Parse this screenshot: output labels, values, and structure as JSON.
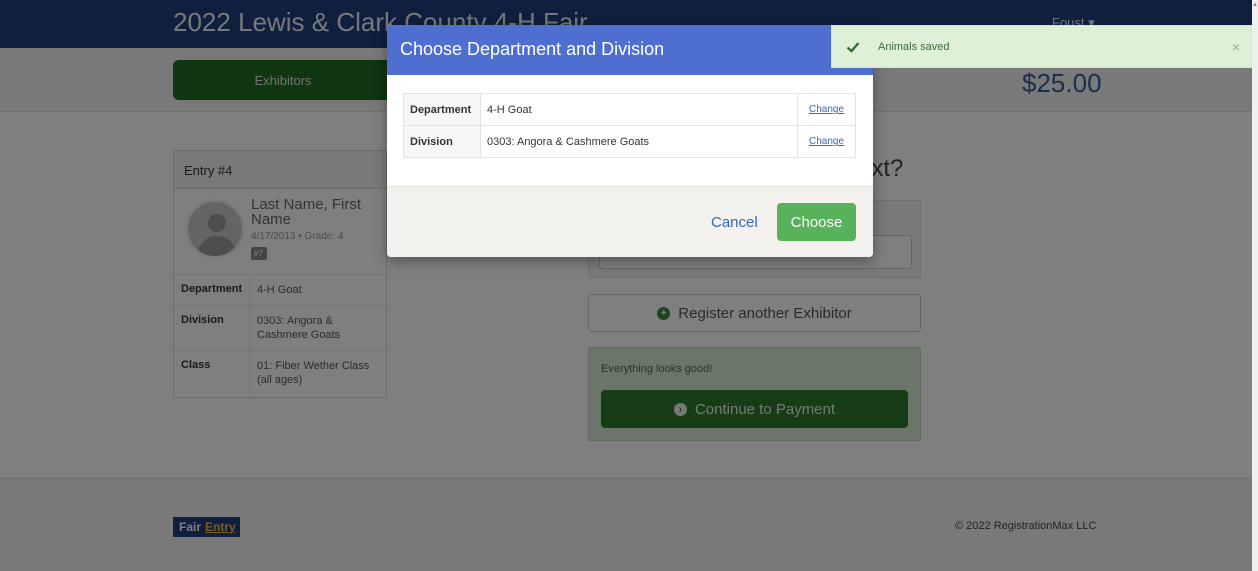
{
  "navbar": {
    "brand": "2022 Lewis & Clark County 4-H Fair",
    "user": "Foust ▾"
  },
  "subbar": {
    "exhibitors_label": "Exhibitors",
    "total": "$25.00"
  },
  "entry": {
    "title": "Entry #4",
    "name": "Last Name, First Name",
    "dob_grade": "4/17/2013 • Grade: 4",
    "tag": "#7",
    "rows": [
      {
        "k": "Department",
        "v": "4-H Goat"
      },
      {
        "k": "Division",
        "v": "0303: Angora & Cashmere Goats"
      },
      {
        "k": "Class",
        "v": "01: Fiber Wether Class (all ages)"
      }
    ]
  },
  "next": {
    "title": "ext?"
  },
  "register_button": "Register another Exhibitor",
  "status": {
    "message": "Everything looks good!",
    "continue_label": "Continue to Payment"
  },
  "footer": {
    "logo_part1": "Fair",
    "logo_part2": "Entry",
    "copyright": "© 2022 RegistrationMax LLC"
  },
  "modal": {
    "title": "Choose Department and Division",
    "rows": [
      {
        "k": "Department",
        "v": "4-H Goat",
        "action": "Change"
      },
      {
        "k": "Division",
        "v": "0303: Angora & Cashmere Goats",
        "action": "Change"
      }
    ],
    "cancel_label": "Cancel",
    "choose_label": "Choose"
  },
  "toast": {
    "message": "Animals saved",
    "close": "×"
  },
  "icons": {
    "check": "check-icon",
    "plus": "plus-circle-icon",
    "arrow": "arrow-circle-right-icon"
  },
  "colors": {
    "navbar": "#1f3f7a",
    "modal_header": "#4e6fcf",
    "choose_button": "#58b15b",
    "continue_button": "#2f7a2f",
    "toast_bg": "#dff0d8"
  }
}
